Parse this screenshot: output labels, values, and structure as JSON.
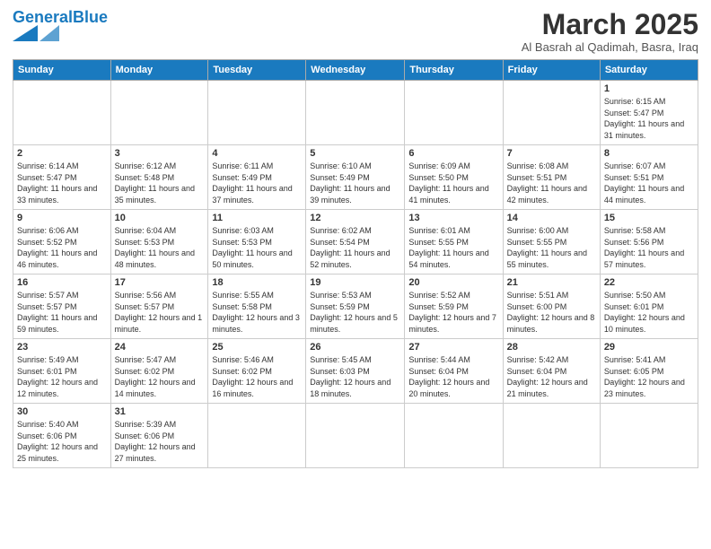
{
  "header": {
    "logo_general": "General",
    "logo_blue": "Blue",
    "month_title": "March 2025",
    "location": "Al Basrah al Qadimah, Basra, Iraq"
  },
  "days_of_week": [
    "Sunday",
    "Monday",
    "Tuesday",
    "Wednesday",
    "Thursday",
    "Friday",
    "Saturday"
  ],
  "weeks": [
    {
      "days": [
        {
          "number": "",
          "info": ""
        },
        {
          "number": "",
          "info": ""
        },
        {
          "number": "",
          "info": ""
        },
        {
          "number": "",
          "info": ""
        },
        {
          "number": "",
          "info": ""
        },
        {
          "number": "",
          "info": ""
        },
        {
          "number": "1",
          "info": "Sunrise: 6:15 AM\nSunset: 5:47 PM\nDaylight: 11 hours\nand 31 minutes."
        }
      ]
    },
    {
      "days": [
        {
          "number": "2",
          "info": "Sunrise: 6:14 AM\nSunset: 5:47 PM\nDaylight: 11 hours\nand 33 minutes."
        },
        {
          "number": "3",
          "info": "Sunrise: 6:12 AM\nSunset: 5:48 PM\nDaylight: 11 hours\nand 35 minutes."
        },
        {
          "number": "4",
          "info": "Sunrise: 6:11 AM\nSunset: 5:49 PM\nDaylight: 11 hours\nand 37 minutes."
        },
        {
          "number": "5",
          "info": "Sunrise: 6:10 AM\nSunset: 5:49 PM\nDaylight: 11 hours\nand 39 minutes."
        },
        {
          "number": "6",
          "info": "Sunrise: 6:09 AM\nSunset: 5:50 PM\nDaylight: 11 hours\nand 41 minutes."
        },
        {
          "number": "7",
          "info": "Sunrise: 6:08 AM\nSunset: 5:51 PM\nDaylight: 11 hours\nand 42 minutes."
        },
        {
          "number": "8",
          "info": "Sunrise: 6:07 AM\nSunset: 5:51 PM\nDaylight: 11 hours\nand 44 minutes."
        }
      ]
    },
    {
      "days": [
        {
          "number": "9",
          "info": "Sunrise: 6:06 AM\nSunset: 5:52 PM\nDaylight: 11 hours\nand 46 minutes."
        },
        {
          "number": "10",
          "info": "Sunrise: 6:04 AM\nSunset: 5:53 PM\nDaylight: 11 hours\nand 48 minutes."
        },
        {
          "number": "11",
          "info": "Sunrise: 6:03 AM\nSunset: 5:53 PM\nDaylight: 11 hours\nand 50 minutes."
        },
        {
          "number": "12",
          "info": "Sunrise: 6:02 AM\nSunset: 5:54 PM\nDaylight: 11 hours\nand 52 minutes."
        },
        {
          "number": "13",
          "info": "Sunrise: 6:01 AM\nSunset: 5:55 PM\nDaylight: 11 hours\nand 54 minutes."
        },
        {
          "number": "14",
          "info": "Sunrise: 6:00 AM\nSunset: 5:55 PM\nDaylight: 11 hours\nand 55 minutes."
        },
        {
          "number": "15",
          "info": "Sunrise: 5:58 AM\nSunset: 5:56 PM\nDaylight: 11 hours\nand 57 minutes."
        }
      ]
    },
    {
      "days": [
        {
          "number": "16",
          "info": "Sunrise: 5:57 AM\nSunset: 5:57 PM\nDaylight: 11 hours\nand 59 minutes."
        },
        {
          "number": "17",
          "info": "Sunrise: 5:56 AM\nSunset: 5:57 PM\nDaylight: 12 hours\nand 1 minute."
        },
        {
          "number": "18",
          "info": "Sunrise: 5:55 AM\nSunset: 5:58 PM\nDaylight: 12 hours\nand 3 minutes."
        },
        {
          "number": "19",
          "info": "Sunrise: 5:53 AM\nSunset: 5:59 PM\nDaylight: 12 hours\nand 5 minutes."
        },
        {
          "number": "20",
          "info": "Sunrise: 5:52 AM\nSunset: 5:59 PM\nDaylight: 12 hours\nand 7 minutes."
        },
        {
          "number": "21",
          "info": "Sunrise: 5:51 AM\nSunset: 6:00 PM\nDaylight: 12 hours\nand 8 minutes."
        },
        {
          "number": "22",
          "info": "Sunrise: 5:50 AM\nSunset: 6:01 PM\nDaylight: 12 hours\nand 10 minutes."
        }
      ]
    },
    {
      "days": [
        {
          "number": "23",
          "info": "Sunrise: 5:49 AM\nSunset: 6:01 PM\nDaylight: 12 hours\nand 12 minutes."
        },
        {
          "number": "24",
          "info": "Sunrise: 5:47 AM\nSunset: 6:02 PM\nDaylight: 12 hours\nand 14 minutes."
        },
        {
          "number": "25",
          "info": "Sunrise: 5:46 AM\nSunset: 6:02 PM\nDaylight: 12 hours\nand 16 minutes."
        },
        {
          "number": "26",
          "info": "Sunrise: 5:45 AM\nSunset: 6:03 PM\nDaylight: 12 hours\nand 18 minutes."
        },
        {
          "number": "27",
          "info": "Sunrise: 5:44 AM\nSunset: 6:04 PM\nDaylight: 12 hours\nand 20 minutes."
        },
        {
          "number": "28",
          "info": "Sunrise: 5:42 AM\nSunset: 6:04 PM\nDaylight: 12 hours\nand 21 minutes."
        },
        {
          "number": "29",
          "info": "Sunrise: 5:41 AM\nSunset: 6:05 PM\nDaylight: 12 hours\nand 23 minutes."
        }
      ]
    },
    {
      "days": [
        {
          "number": "30",
          "info": "Sunrise: 5:40 AM\nSunset: 6:06 PM\nDaylight: 12 hours\nand 25 minutes."
        },
        {
          "number": "31",
          "info": "Sunrise: 5:39 AM\nSunset: 6:06 PM\nDaylight: 12 hours\nand 27 minutes."
        },
        {
          "number": "",
          "info": ""
        },
        {
          "number": "",
          "info": ""
        },
        {
          "number": "",
          "info": ""
        },
        {
          "number": "",
          "info": ""
        },
        {
          "number": "",
          "info": ""
        }
      ]
    }
  ]
}
